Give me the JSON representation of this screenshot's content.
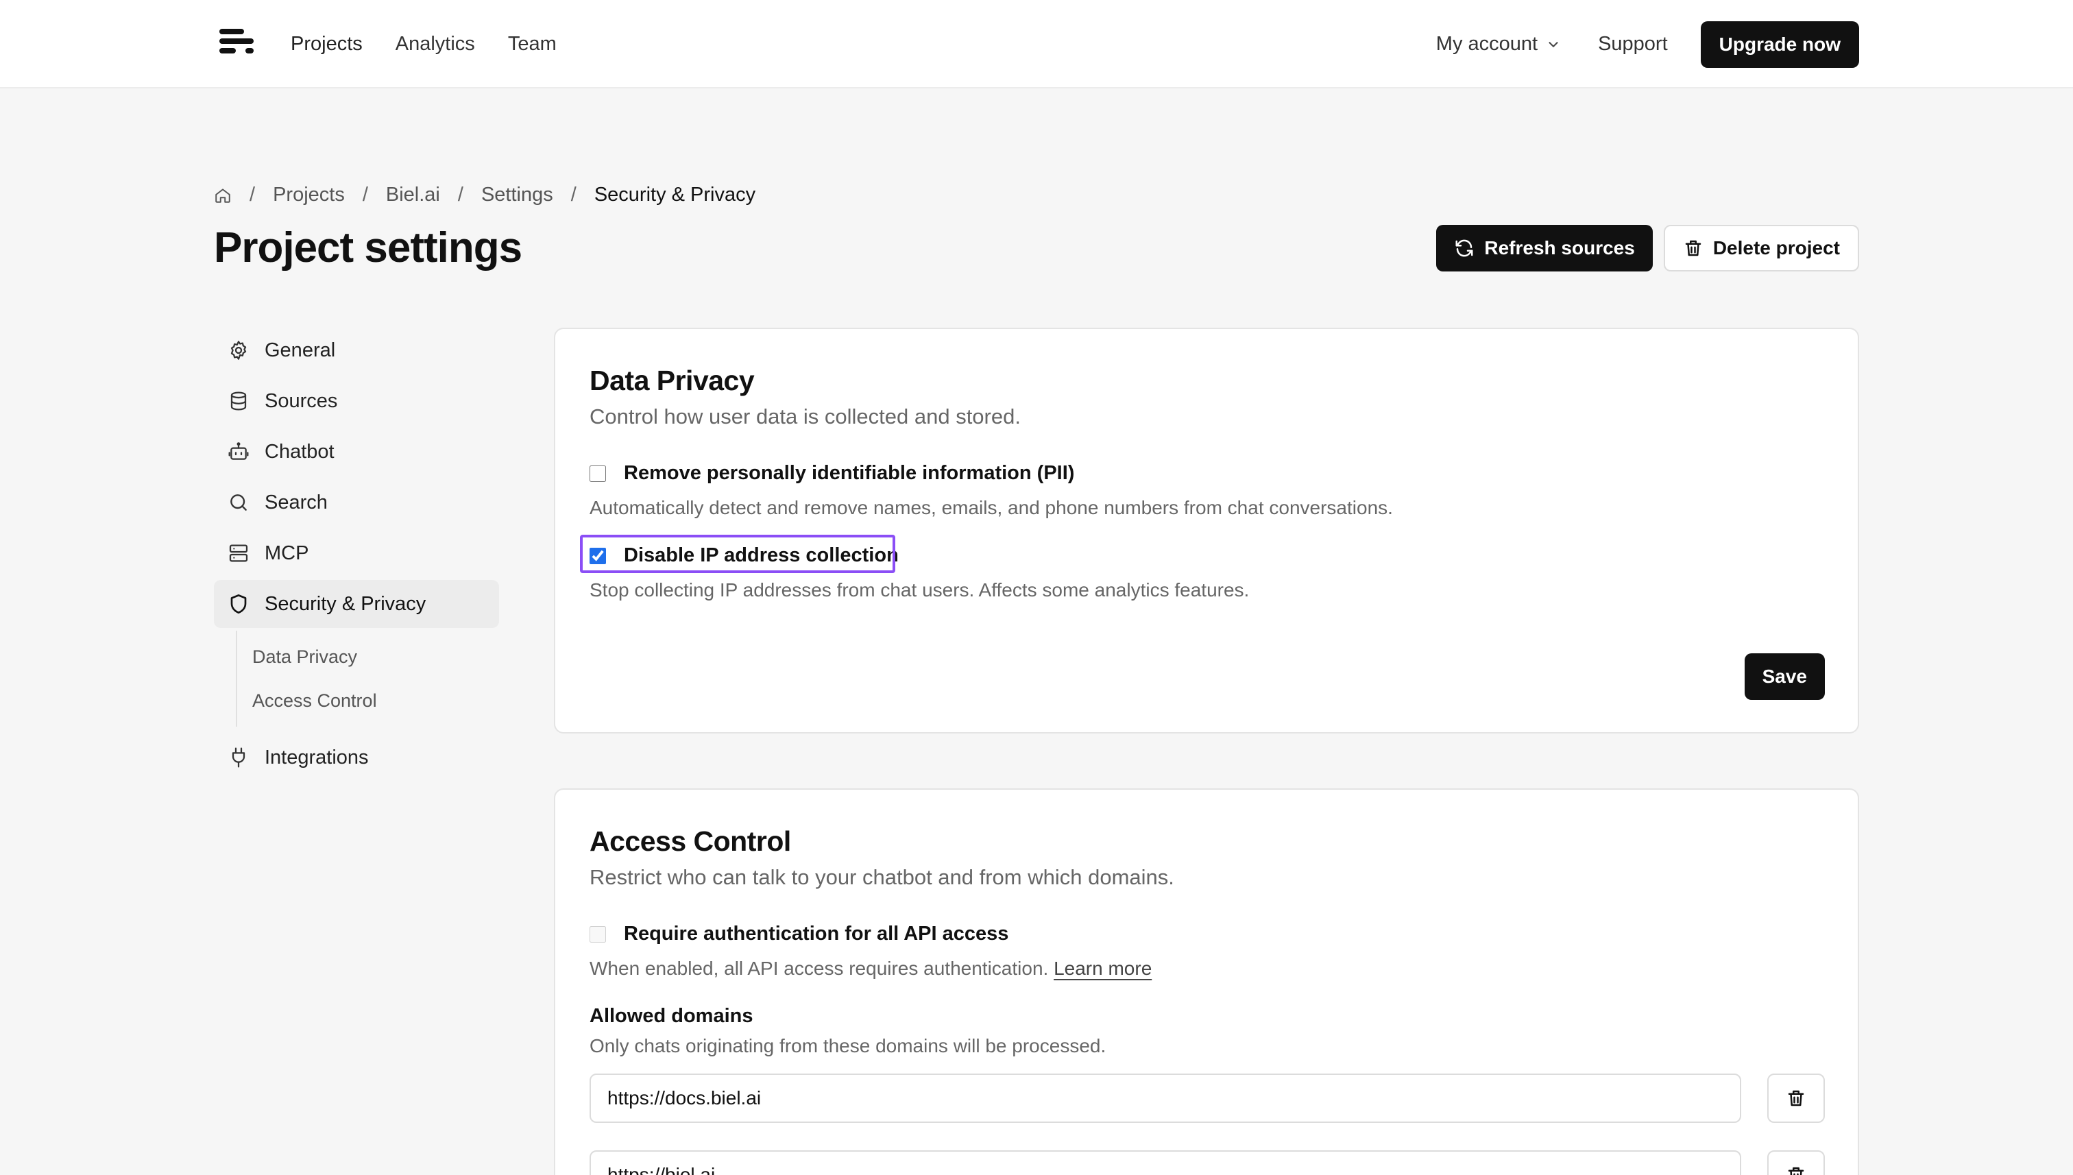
{
  "nav": {
    "links": [
      "Projects",
      "Analytics",
      "Team"
    ],
    "account_label": "My account",
    "support_label": "Support",
    "upgrade_label": "Upgrade now"
  },
  "breadcrumb": {
    "items": [
      "Projects",
      "Biel.ai",
      "Settings"
    ],
    "current": "Security & Privacy",
    "separator": "/"
  },
  "page": {
    "title": "Project settings",
    "refresh_label": "Refresh sources",
    "delete_label": "Delete project"
  },
  "sidebar": {
    "items": [
      {
        "label": "General",
        "icon": "gear-icon"
      },
      {
        "label": "Sources",
        "icon": "database-icon"
      },
      {
        "label": "Chatbot",
        "icon": "bot-icon"
      },
      {
        "label": "Search",
        "icon": "search-icon"
      },
      {
        "label": "MCP",
        "icon": "server-icon"
      },
      {
        "label": "Security & Privacy",
        "icon": "shield-icon",
        "active": true
      },
      {
        "label": "Integrations",
        "icon": "plug-icon"
      }
    ],
    "sub_items": [
      "Data Privacy",
      "Access Control"
    ]
  },
  "data_privacy": {
    "title": "Data Privacy",
    "description": "Control how user data is collected and stored.",
    "options": [
      {
        "label": "Remove personally identifiable information (PII)",
        "help": "Automatically detect and remove names, emails, and phone numbers from chat conversations.",
        "checked": false
      },
      {
        "label": "Disable IP address collection",
        "help": "Stop collecting IP addresses from chat users. Affects some analytics features.",
        "checked": true
      }
    ],
    "save_label": "Save"
  },
  "access_control": {
    "title": "Access Control",
    "description": "Restrict who can talk to your chatbot and from which domains.",
    "auth_label": "Require authentication for all API access",
    "auth_help": "When enabled, all API access requires authentication.",
    "learn_more": "Learn more",
    "allowed_domains_title": "Allowed domains",
    "allowed_domains_desc": "Only chats originating from these domains will be processed.",
    "domains": [
      "https://docs.biel.ai",
      "https://biel.ai"
    ]
  },
  "colors": {
    "accent": "#8b4ef6",
    "checkbox": "#1f6feb",
    "primary_button": "#111111"
  }
}
